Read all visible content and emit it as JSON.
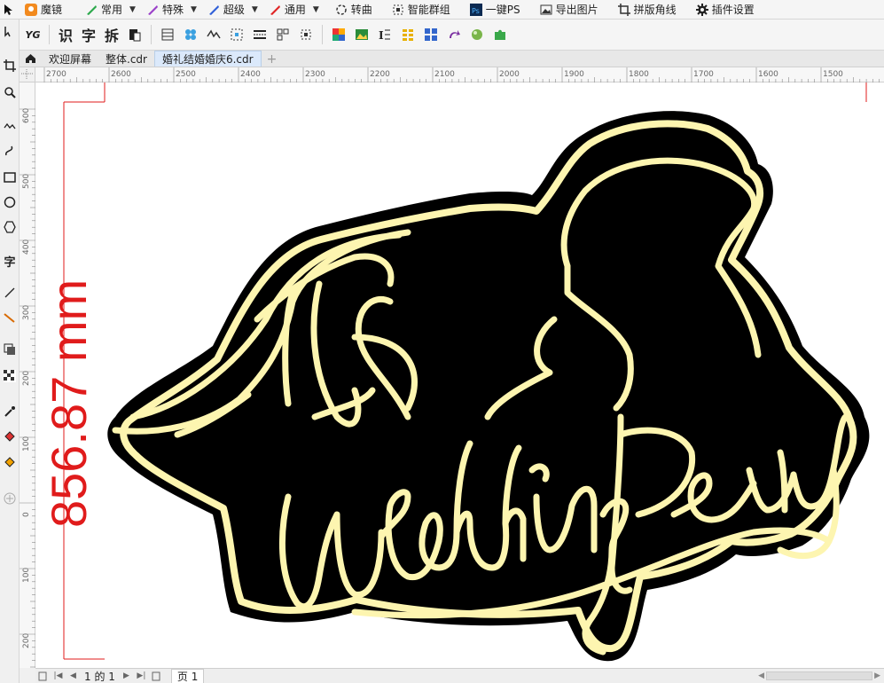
{
  "plugin_bar": {
    "items": [
      {
        "label": "魔镜",
        "icon": "magic-mirror-icon",
        "caret": false
      },
      {
        "label": "常用",
        "icon": "green-pen-icon",
        "caret": true
      },
      {
        "label": "特殊",
        "icon": "purple-pen-icon",
        "caret": true
      },
      {
        "label": "超级",
        "icon": "blue-pen-icon",
        "caret": true
      },
      {
        "label": "通用",
        "icon": "red-pen-icon",
        "caret": true
      },
      {
        "label": "转曲",
        "icon": "curve-icon",
        "caret": false
      },
      {
        "label": "智能群组",
        "icon": "group-icon",
        "caret": false
      },
      {
        "label": "一键PS",
        "icon": "ps-icon",
        "caret": false
      },
      {
        "label": "导出图片",
        "icon": "image-export-icon",
        "caret": false
      },
      {
        "label": "拼版角线",
        "icon": "crop-marks-icon",
        "caret": false
      },
      {
        "label": "插件设置",
        "icon": "gear-icon",
        "caret": false
      }
    ]
  },
  "toolbar": {
    "yg_label": "YG",
    "shi_label": "识",
    "zi_label": "字",
    "chai_label": "拆"
  },
  "tabs": {
    "items": [
      {
        "label": "欢迎屏幕",
        "active": false
      },
      {
        "label": "整体.cdr",
        "active": false
      },
      {
        "label": "婚礼结婚婚庆6.cdr",
        "active": true
      }
    ],
    "add_label": "+"
  },
  "ruler_h": {
    "labels": [
      "2700",
      "2600",
      "2500",
      "2400",
      "2300",
      "2200",
      "2100",
      "2000",
      "1900",
      "1800",
      "1700",
      "1600",
      "1500"
    ]
  },
  "ruler_v": {
    "labels": [
      "600",
      "500",
      "400",
      "300",
      "200",
      "100",
      "0",
      "100",
      "200"
    ]
  },
  "canvas": {
    "dimension_text": "856.87 mm",
    "dimension_color": "#e01b1b",
    "artwork_text": "Wedding Party",
    "neon_color": "#fdf5b0",
    "silhouette_color": "#000000"
  },
  "page_bar": {
    "page_of": "1 的 1",
    "page_tab": "页 1"
  },
  "colors": {
    "accent": "#3a7fd5",
    "active_tab_bg": "#dbe9fb"
  }
}
